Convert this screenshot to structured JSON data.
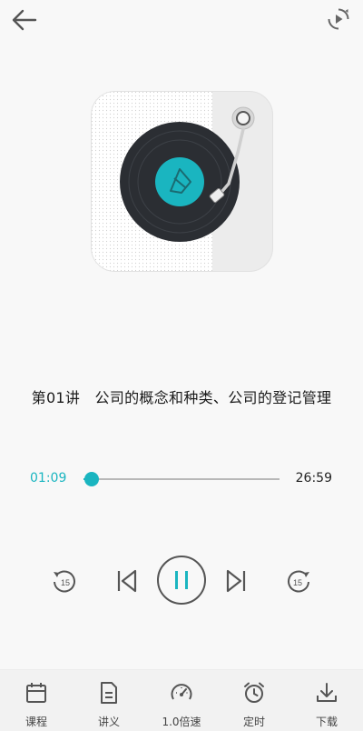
{
  "header": {
    "back_icon": "arrow-left-icon",
    "loop_icon": "repeat-circle-icon"
  },
  "cover": {
    "icon": "vinyl-record-player-icon"
  },
  "track": {
    "title": "第01讲　公司的概念和种类、公司的登记管理"
  },
  "player": {
    "current_time": "01:09",
    "total_time": "26:59",
    "progress": 0.043,
    "rewind_seconds": "15",
    "forward_seconds": "15",
    "state": "playing"
  },
  "colors": {
    "accent": "#1ab5c0",
    "icon_gray": "#555555",
    "background": "#f8f8f8"
  },
  "bottom_nav": {
    "items": [
      {
        "label": "课程",
        "icon": "calendar-icon"
      },
      {
        "label": "讲义",
        "icon": "document-icon"
      },
      {
        "label": "1.0倍速",
        "icon": "speedometer-icon"
      },
      {
        "label": "定时",
        "icon": "alarm-clock-icon"
      },
      {
        "label": "下载",
        "icon": "download-icon"
      }
    ]
  }
}
